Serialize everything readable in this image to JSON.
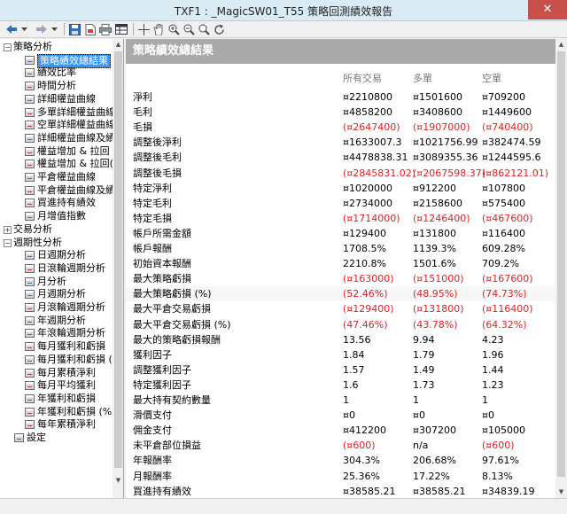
{
  "window": {
    "title": "TXF1 : _MagicSW01_T55 策略回測績效報告"
  },
  "tree": {
    "items": [
      {
        "label": "策略分析",
        "level": 0,
        "expander": "−"
      },
      {
        "label": "策略績效總結果",
        "level": 1,
        "selected": true
      },
      {
        "label": "績效比率",
        "level": 1
      },
      {
        "label": "時間分析",
        "level": 1
      },
      {
        "label": "詳細權益曲線",
        "level": 1
      },
      {
        "label": "多單詳細權益曲線",
        "level": 1
      },
      {
        "label": "空單詳細權益曲線",
        "level": 1
      },
      {
        "label": "詳細權益曲線及績效",
        "level": 1
      },
      {
        "label": "權益增加 & 拉回",
        "level": 1
      },
      {
        "label": "權益增加 & 拉回(%)",
        "level": 1
      },
      {
        "label": "平倉權益曲線",
        "level": 1
      },
      {
        "label": "平倉權益曲線及績效",
        "level": 1
      },
      {
        "label": "買進持有績效",
        "level": 1
      },
      {
        "label": "月增值指數",
        "level": 1
      },
      {
        "label": "交易分析",
        "level": 0,
        "expander": "+"
      },
      {
        "label": "週期性分析",
        "level": 0,
        "expander": "−"
      },
      {
        "label": "日週期分析",
        "level": 1
      },
      {
        "label": "日滾輪週期分析",
        "level": 1
      },
      {
        "label": "月分析",
        "level": 1
      },
      {
        "label": "月週期分析",
        "level": 1
      },
      {
        "label": "月滾輪週期分析",
        "level": 1
      },
      {
        "label": "年週期分析",
        "level": 1
      },
      {
        "label": "年滾輪週期分析",
        "level": 1
      },
      {
        "label": "每月獲利和虧損",
        "level": 1
      },
      {
        "label": "每月獲利和虧損 (%)",
        "level": 1
      },
      {
        "label": "每月累積淨利",
        "level": 1
      },
      {
        "label": "每月平均獲利",
        "level": 1
      },
      {
        "label": "年獲利和虧損",
        "level": 1
      },
      {
        "label": "年獲利和虧損 (%)",
        "level": 1
      },
      {
        "label": "每年累積淨利",
        "level": 1
      },
      {
        "label": "設定",
        "level": 0
      }
    ]
  },
  "report": {
    "header": "策略績效總結果",
    "columns": [
      "所有交易",
      "多單",
      "空單"
    ],
    "rows": [
      {
        "label": "淨利",
        "values": [
          "¤2210800",
          "¤1501600",
          "¤709200"
        ],
        "neg": [
          false,
          false,
          false
        ]
      },
      {
        "label": "毛利",
        "values": [
          "¤4858200",
          "¤3408600",
          "¤1449600"
        ],
        "neg": [
          false,
          false,
          false
        ]
      },
      {
        "label": "毛損",
        "values": [
          "(¤2647400)",
          "(¤1907000)",
          "(¤740400)"
        ],
        "neg": [
          true,
          true,
          true
        ]
      },
      {
        "label": "調整後淨利",
        "values": [
          "¤1633007.3",
          "¤1021756.99",
          "¤382474.59"
        ],
        "neg": [
          false,
          false,
          false
        ]
      },
      {
        "label": "調整後毛利",
        "values": [
          "¤4478838.31",
          "¤3089355.36",
          "¤1244595.6"
        ],
        "neg": [
          false,
          false,
          false
        ]
      },
      {
        "label": "調整後毛損",
        "values": [
          "(¤2845831.02)",
          "(¤2067598.37)",
          "(¤862121.01)"
        ],
        "neg": [
          true,
          true,
          true
        ]
      },
      {
        "label": "特定淨利",
        "values": [
          "¤1020000",
          "¤912200",
          "¤107800"
        ],
        "neg": [
          false,
          false,
          false
        ]
      },
      {
        "label": "特定毛利",
        "values": [
          "¤2734000",
          "¤2158600",
          "¤575400"
        ],
        "neg": [
          false,
          false,
          false
        ]
      },
      {
        "label": "特定毛損",
        "values": [
          "(¤1714000)",
          "(¤1246400)",
          "(¤467600)"
        ],
        "neg": [
          true,
          true,
          true
        ]
      },
      {
        "label": "帳戶所需金額",
        "values": [
          "¤129400",
          "¤131800",
          "¤116400"
        ],
        "neg": [
          false,
          false,
          false
        ]
      },
      {
        "label": "帳戶報酬",
        "values": [
          "1708.5%",
          "1139.3%",
          "609.28%"
        ],
        "neg": [
          false,
          false,
          false
        ]
      },
      {
        "label": "初始資本報酬",
        "values": [
          "2210.8%",
          "1501.6%",
          "709.2%"
        ],
        "neg": [
          false,
          false,
          false
        ]
      },
      {
        "label": "最大策略虧損",
        "values": [
          "(¤163000)",
          "(¤151000)",
          "(¤167600)"
        ],
        "neg": [
          true,
          true,
          true
        ]
      },
      {
        "label": "最大策略虧損 (%)",
        "values": [
          "(52.46%)",
          "(48.95%)",
          "(74.73%)"
        ],
        "neg": [
          true,
          true,
          true
        ]
      },
      {
        "label": "最大平倉交易虧損",
        "values": [
          "(¤129400)",
          "(¤131800)",
          "(¤116400)"
        ],
        "neg": [
          true,
          true,
          true
        ]
      },
      {
        "label": "最大平倉交易虧損 (%)",
        "values": [
          "(47.46%)",
          "(43.78%)",
          "(64.32%)"
        ],
        "neg": [
          true,
          true,
          true
        ]
      },
      {
        "label": "最大的策略虧損報酬",
        "values": [
          "13.56",
          "9.94",
          "4.23"
        ],
        "neg": [
          false,
          false,
          false
        ]
      },
      {
        "label": "獲利因子",
        "values": [
          "1.84",
          "1.79",
          "1.96"
        ],
        "neg": [
          false,
          false,
          false
        ]
      },
      {
        "label": "調整獲利因子",
        "values": [
          "1.57",
          "1.49",
          "1.44"
        ],
        "neg": [
          false,
          false,
          false
        ]
      },
      {
        "label": "特定獲利因子",
        "values": [
          "1.6",
          "1.73",
          "1.23"
        ],
        "neg": [
          false,
          false,
          false
        ]
      },
      {
        "label": "最大持有契約數量",
        "values": [
          "1",
          "1",
          "1"
        ],
        "neg": [
          false,
          false,
          false
        ]
      },
      {
        "label": "滑價支付",
        "values": [
          "¤0",
          "¤0",
          "¤0"
        ],
        "neg": [
          false,
          false,
          false
        ]
      },
      {
        "label": "佣金支付",
        "values": [
          "¤412200",
          "¤307200",
          "¤105000"
        ],
        "neg": [
          false,
          false,
          false
        ]
      },
      {
        "label": "未平倉部位損益",
        "values": [
          "(¤600)",
          "n/a",
          "(¤600)"
        ],
        "neg": [
          true,
          false,
          true
        ]
      },
      {
        "label": "年報酬率",
        "values": [
          "304.3%",
          "206.68%",
          "97.61%"
        ],
        "neg": [
          false,
          false,
          false
        ]
      },
      {
        "label": "月報酬率",
        "values": [
          "25.36%",
          "17.22%",
          "8.13%"
        ],
        "neg": [
          false,
          false,
          false
        ]
      },
      {
        "label": "買進持有績效",
        "values": [
          "¤38585.21",
          "¤38585.21",
          "¤34839.19"
        ],
        "neg": [
          false,
          false,
          false
        ]
      }
    ]
  },
  "colors": {
    "negative": "#e02020",
    "header_bg": "#a9a9a9",
    "selection": "#3399ff"
  }
}
